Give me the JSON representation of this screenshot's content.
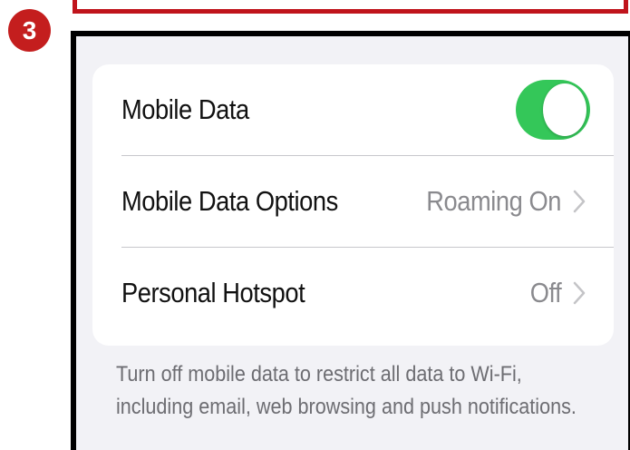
{
  "step": {
    "number": "3"
  },
  "colors": {
    "badge": "#c41e1e",
    "frame": "#000000",
    "top_frame": "#c0141c",
    "toggle_on": "#34c759",
    "background": "#f2f2f6"
  },
  "settings": {
    "rows": [
      {
        "label": "Mobile Data",
        "control": "toggle",
        "toggle_on": true
      },
      {
        "label": "Mobile Data Options",
        "value": "Roaming On",
        "icon": "chevron-right-icon"
      },
      {
        "label": "Personal Hotspot",
        "value": "Off",
        "icon": "chevron-right-icon"
      }
    ]
  },
  "footer": {
    "line1": "Turn off mobile data to restrict all data to Wi-Fi,",
    "line2": "including email, web browsing and push notifications."
  }
}
